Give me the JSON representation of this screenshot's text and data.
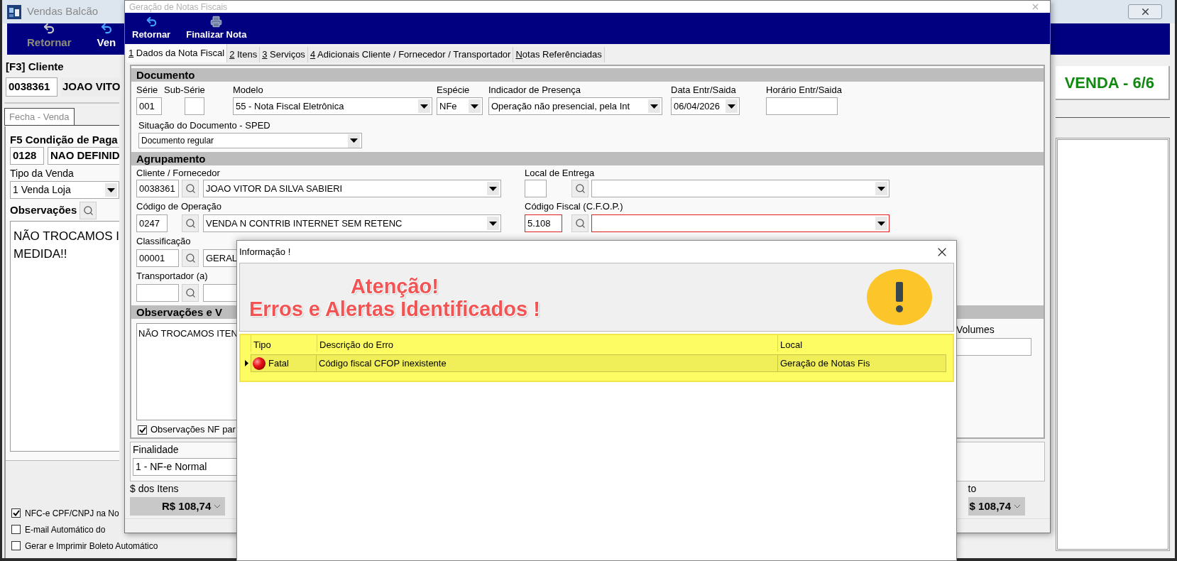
{
  "back_window": {
    "title": "Vendas Balcão",
    "toolbar": [
      {
        "label": "Retornar",
        "disabled": true
      },
      {
        "label": "Ven",
        "disabled": false
      }
    ],
    "client_label": "[F3] Cliente",
    "client_code": "0038361",
    "client_name": "JOAO VITO",
    "sale_step": "VENDA - 6/6",
    "tabs": [
      {
        "label": "Fecha - Venda",
        "selected": true
      }
    ],
    "payment_label": "F5 Condição de Paga",
    "payment_code": "0128",
    "payment_name": "NAO DEFINID",
    "sale_type_label": "Tipo da Venda",
    "sale_type_value": "1 Venda Loja",
    "notes_label": "Observações",
    "notes_lines": [
      "NÃO TROCAMOS I",
      "MEDIDA!!"
    ],
    "options": [
      {
        "label": "NFC-e CPF/CNPJ na No",
        "checked": true
      },
      {
        "label": "E-mail Automático do",
        "checked": false
      },
      {
        "label": "Gerar e Imprimir Boleto Automático",
        "checked": false
      }
    ]
  },
  "nf_window": {
    "title": "Geração de Notas Fiscais",
    "toolbar": [
      {
        "label": "Retornar",
        "kind": "undo"
      },
      {
        "label": "Finalizar Nota",
        "kind": "printer"
      }
    ],
    "tabs": [
      {
        "label": "1 Dados da Nota Fiscal",
        "selected": true
      },
      {
        "label": "2 Itens",
        "selected": false
      },
      {
        "label": "3 Serviços",
        "selected": false
      },
      {
        "label": "4 Adicionais Cliente / Fornecedor / Transportador",
        "selected": false
      },
      {
        "label": "Notas Referênciadas",
        "selected": false
      }
    ],
    "documento": {
      "title": "Documento",
      "serie": {
        "label": "Série",
        "value": "001"
      },
      "sub_serie": {
        "label": "Sub-Série"
      },
      "modelo": {
        "label": "Modelo",
        "value": "55 - Nota Fiscal Eletrônica"
      },
      "especie": {
        "label": "Espécie",
        "value": "NFe"
      },
      "indicador_presenca": {
        "label": "Indicador de Presença",
        "value": "Operação não presencial, pela Int"
      },
      "data_entr_saida": {
        "label": "Data Entr/Saida",
        "value": "06/04/2026"
      },
      "horario_entr_saida": {
        "label": "Horário Entr/Saida"
      },
      "situacao": {
        "label": "Situação do Documento - SPED",
        "value": "Documento regular"
      }
    },
    "agrupamento": {
      "title": "Agrupamento",
      "cliente": {
        "label": "Cliente / Fornecedor",
        "code": "0038361",
        "name": "JOAO VITOR DA SILVA SABIERI"
      },
      "local_entrega": {
        "label": "Local de Entrega"
      },
      "codigo_operacao": {
        "label": "Código de Operação",
        "code": "0247",
        "name": "VENDA N CONTRIB INTERNET SEM RETENC"
      },
      "cfop": {
        "label": "Código Fiscal (C.F.O.P.)",
        "code": "5.108",
        "invalid": true
      },
      "classificacao": {
        "label": "Classificação",
        "code": "00001",
        "name": "GERAL"
      },
      "transportador": {
        "label": "Transportador (a)"
      }
    },
    "observacoes": {
      "title": "Observações e V",
      "text": "NÃO TROCAMOS ITEN",
      "option": {
        "label": "Observações NF par",
        "checked": true
      },
      "volumes_label": "Volumes"
    },
    "finalidade": {
      "label": "Finalidade",
      "value": "1 - NF-e Normal"
    },
    "totals": [
      {
        "label": "$ dos Itens",
        "value": "R$ 108,74"
      },
      {
        "label": "to",
        "value": "$ 108,74"
      }
    ]
  },
  "dialog": {
    "title": "Informação !",
    "heading": [
      "Atenção!",
      "Erros e Alertas Identificados !"
    ],
    "columns": [
      "Tipo",
      "Descrição do Erro",
      "Local"
    ],
    "rows": [
      {
        "kind": "fatal",
        "type": "Fatal",
        "description": "Código fiscal CFOP inexistente",
        "location": "Geração de Notas Fis",
        "selected": true
      }
    ]
  }
}
